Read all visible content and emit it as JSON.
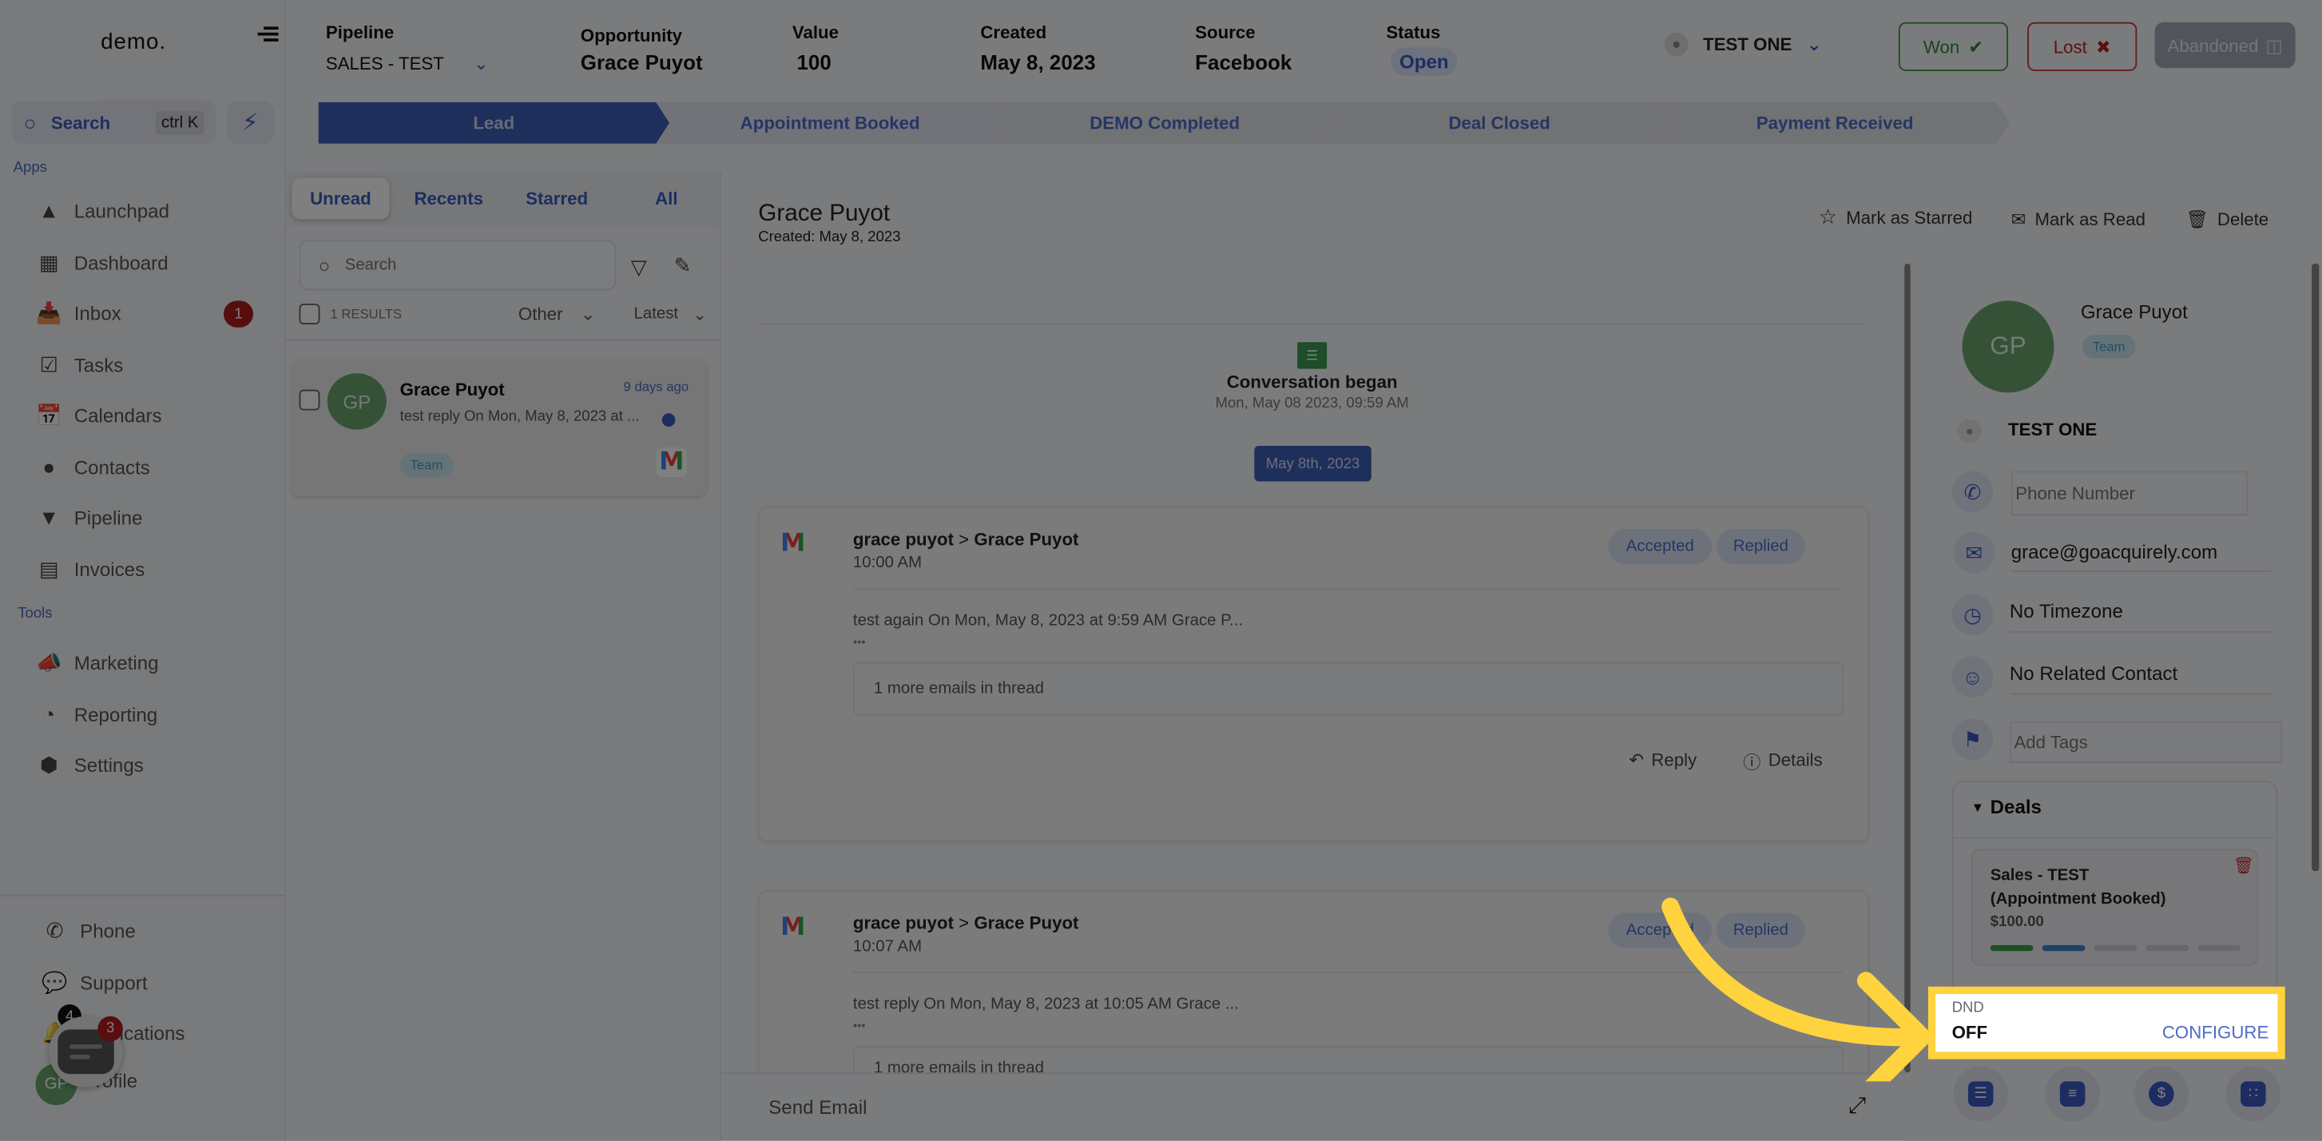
{
  "sidebar": {
    "logo": "demo.",
    "search_label": "Search",
    "search_shortcut": "ctrl K",
    "apps_label": "Apps",
    "tools_label": "Tools",
    "apps": [
      {
        "label": "Launchpad",
        "icon": "launchpad-icon"
      },
      {
        "label": "Dashboard",
        "icon": "dashboard-icon"
      },
      {
        "label": "Inbox",
        "icon": "inbox-icon",
        "badge": "1"
      },
      {
        "label": "Tasks",
        "icon": "tasks-icon"
      },
      {
        "label": "Calendars",
        "icon": "calendar-icon"
      },
      {
        "label": "Contacts",
        "icon": "contacts-icon"
      },
      {
        "label": "Pipeline",
        "icon": "pipeline-icon"
      },
      {
        "label": "Invoices",
        "icon": "invoices-icon"
      }
    ],
    "tools": [
      {
        "label": "Marketing",
        "icon": "megaphone-icon"
      },
      {
        "label": "Reporting",
        "icon": "reporting-icon"
      },
      {
        "label": "Settings",
        "icon": "settings-icon"
      }
    ],
    "bottom": [
      {
        "label": "Phone",
        "icon": "phone-icon"
      },
      {
        "label": "Support",
        "icon": "support-icon"
      },
      {
        "label": "Notifications",
        "icon": "bell-icon",
        "badge": "4"
      },
      {
        "label": "Profile",
        "avatar": "GP"
      }
    ],
    "chat_widget_badge": "3"
  },
  "header": {
    "pipeline_label": "Pipeline",
    "pipeline_value": "SALES - TEST",
    "opportunity_label": "Opportunity",
    "opportunity_value": "Grace Puyot",
    "value_label": "Value",
    "value_value": "100",
    "created_label": "Created",
    "created_value": "May 8, 2023",
    "source_label": "Source",
    "source_value": "Facebook",
    "status_label": "Status",
    "status_value": "Open",
    "owner": "TEST ONE",
    "won_label": "Won",
    "lost_label": "Lost",
    "abandoned_label": "Abandoned",
    "stages": [
      "Lead",
      "Appointment Booked",
      "DEMO Completed",
      "Deal Closed",
      "Payment Received"
    ],
    "active_stage": 0
  },
  "conversations": {
    "tabs": [
      "Unread",
      "Recents",
      "Starred",
      "All"
    ],
    "active_tab": "Unread",
    "search_placeholder": "Search",
    "results": "1 RESULTS",
    "filter_type": "Other",
    "sort": "Latest",
    "items": [
      {
        "initials": "GP",
        "name": "Grace Puyot",
        "time": "9 days ago",
        "preview": "test reply On Mon, May 8, 2023 at ...",
        "tag": "Team",
        "channel": "gmail",
        "unread": true
      }
    ]
  },
  "main": {
    "contact_name": "Grace Puyot",
    "created": "Created: May 8, 2023",
    "mark_starred": "Mark as Starred",
    "mark_read": "Mark as Read",
    "delete": "Delete",
    "conversation_began": "Conversation began",
    "conversation_began_time": "Mon, May 08 2023, 09:59 AM",
    "date_chip": "May 8th, 2023",
    "emails": [
      {
        "from": "grace puyot",
        "to": "Grace Puyot",
        "time": "10:00 AM",
        "statuses": [
          "Accepted",
          "Replied"
        ],
        "body": "test again On Mon, May 8, 2023 at 9:59 AM Grace P...",
        "ellipsis": "•••",
        "thread_note": "1 more emails in thread",
        "reply": "Reply",
        "details": "Details"
      },
      {
        "from": "grace puyot",
        "to": "Grace Puyot",
        "time": "10:07 AM",
        "statuses": [
          "Accepted",
          "Replied"
        ],
        "body": "test reply On Mon, May 8, 2023 at 10:05 AM Grace ...",
        "ellipsis": "•••",
        "thread_note": "1 more emails in thread"
      }
    ],
    "composer_label": "Send Email"
  },
  "contact": {
    "initials": "GP",
    "name": "Grace Puyot",
    "tag": "Team",
    "owner": "TEST ONE",
    "phone_placeholder": "Phone Number",
    "email": "grace@goacquirely.com",
    "timezone": "No Timezone",
    "related": "No Related Contact",
    "tags_placeholder": "Add Tags",
    "deals_label": "Deals",
    "deal": {
      "title": "Sales - TEST (Appointment Booked)",
      "amount": "$100.00",
      "stage_progress": "2 of 5"
    },
    "dnd_label": "DND",
    "dnd_value": "OFF",
    "dnd_action": "CONFIGURE"
  },
  "colors": {
    "accent": "#3b5bc4",
    "won": "#2d8a2d",
    "lost": "#b22222",
    "highlight": "#ffd33d",
    "avatar": "#6aa46e"
  }
}
